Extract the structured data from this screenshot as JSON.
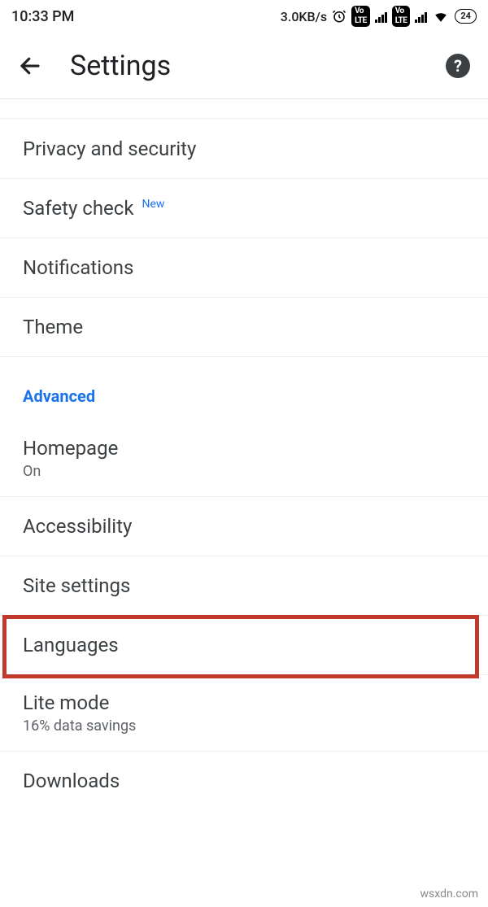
{
  "status": {
    "time": "10:33 PM",
    "net_speed": "3.0KB/s",
    "volte_badge": "Vo\nLTE",
    "battery_pct": "24"
  },
  "header": {
    "title": "Settings"
  },
  "section_label": "Advanced",
  "items": {
    "privacy": {
      "label": "Privacy and security"
    },
    "safety": {
      "label": "Safety check",
      "badge": "New"
    },
    "notifications": {
      "label": "Notifications"
    },
    "theme": {
      "label": "Theme"
    },
    "homepage": {
      "label": "Homepage",
      "sub": "On"
    },
    "accessibility": {
      "label": "Accessibility"
    },
    "site": {
      "label": "Site settings"
    },
    "languages": {
      "label": "Languages"
    },
    "lite": {
      "label": "Lite mode",
      "sub": "16% data savings"
    },
    "downloads": {
      "label": "Downloads"
    }
  },
  "watermark": "wsxdn.com"
}
